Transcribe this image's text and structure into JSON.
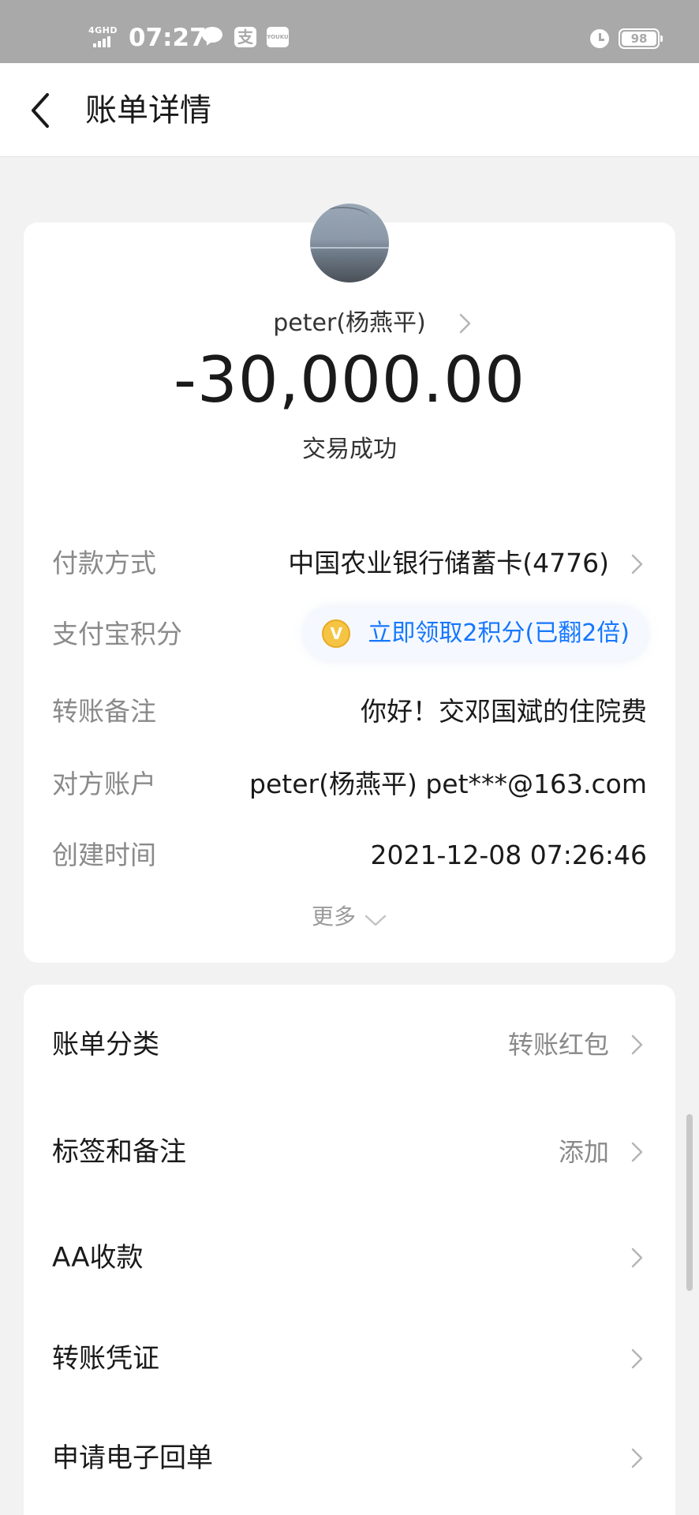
{
  "status_bar": {
    "network": "4GHD",
    "time": "07:27",
    "alipay_glyph": "支",
    "youku_glyph": "YOUKU",
    "battery": "98"
  },
  "nav": {
    "title": "账单详情"
  },
  "transaction": {
    "payee": "peter(杨燕平)",
    "amount": "-30,000.00",
    "status": "交易成功"
  },
  "details": {
    "payment_method_label": "付款方式",
    "payment_method_value": "中国农业银行储蓄卡(4776)",
    "points_label": "支付宝积分",
    "points_value": "立即领取2积分(已翻2倍)",
    "points_coin_glyph": "V",
    "memo_label": "转账备注",
    "memo_value": "你好！交邓国斌的住院费",
    "account_label": "对方账户",
    "account_value": "peter(杨燕平) pet***@163.com",
    "created_label": "创建时间",
    "created_value": "2021-12-08 07:26:46",
    "more": "更多"
  },
  "actions": {
    "category_label": "账单分类",
    "category_value": "转账红包",
    "tags_label": "标签和备注",
    "tags_value": "添加",
    "aa_label": "AA收款",
    "voucher_label": "转账凭证",
    "receipt_label": "申请电子回单"
  },
  "colors": {
    "accent_blue": "#1677ff",
    "status_bar": "#a9a9a9",
    "background": "#f2f2f2"
  },
  "icons": [
    "back-arrow-icon",
    "chevron-right-icon",
    "chevron-down-icon",
    "coin-icon",
    "chat-bubble-icon",
    "alarm-icon",
    "battery-icon",
    "signal-icon"
  ]
}
